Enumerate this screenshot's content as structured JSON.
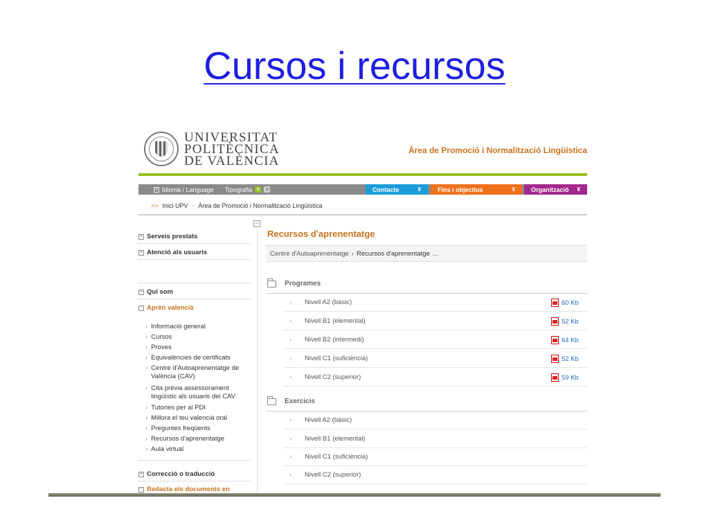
{
  "slide": {
    "title": "Cursos i recursos"
  },
  "header": {
    "university_lines": [
      "UNIVERSITAT",
      "POLITÈCNICA",
      "DE VALÈNCIA"
    ],
    "area_title": "Àrea de Promoció i Normalització Lingüística"
  },
  "navbar": {
    "language": "Idioma / Language",
    "typography": "Tipografia",
    "typo_a": "a",
    "typo_b": "a",
    "tabs": [
      {
        "label": "Contacte",
        "color": "#1c9cd8"
      },
      {
        "label": "Fins i objectius",
        "color": "#f0711d"
      },
      {
        "label": "Organització",
        "color": "#a3288c"
      }
    ]
  },
  "breadcrumb": {
    "arrows": ">>",
    "home": "Inici UPV",
    "current": "Àrea de Promoció i Normalització Lingüística"
  },
  "sidebar": {
    "top": [
      {
        "label": "Serveis prestats",
        "toggle": "+"
      },
      {
        "label": "Atenció als usuaris",
        "toggle": "+"
      }
    ],
    "qui_som": {
      "label": "Qui som",
      "toggle": "+"
    },
    "apren": {
      "label": "Aprèn valencià",
      "toggle": "-"
    },
    "sub_items": [
      "Informació general",
      "Cursos",
      "Proves",
      "Equivalències de certificats",
      "Centre d'Autoaprenentatge de València (CAV)",
      "Cita prèvia assessorament lingüístic als usuaris del CAV",
      "Tutories per al PDI",
      "Millora el teu valencià oral",
      "Preguntes freqüents",
      "Recursos d'aprenentatge",
      "Aula virtual"
    ],
    "bottom": [
      {
        "label": "Correcció o traducció",
        "toggle": "+"
      },
      {
        "label": "Redacta els documents en",
        "toggle": "-"
      }
    ]
  },
  "main": {
    "title": "Recursos d'aprenentatge",
    "crumb_parent": "Centre d'Autoaprenentatge",
    "crumb_sep": "›",
    "crumb_current": "Recursos d'aprenentatge",
    "crumb_more": "...",
    "sections": [
      {
        "title": "Programes",
        "rows": [
          {
            "label": "Nivell A2 (bàsic)",
            "size": "60 Kb"
          },
          {
            "label": "Nivell B1 (elemental)",
            "size": "52 Kb"
          },
          {
            "label": "Nivell B2 (intermedi)",
            "size": "64 Kb"
          },
          {
            "label": "Nivell C1 (suficiència)",
            "size": "52 Kb"
          },
          {
            "label": "Nivell C2 (superior)",
            "size": "59 Kb"
          }
        ]
      },
      {
        "title": "Exercicis",
        "rows": [
          {
            "label": "Nivell A2 (bàsic)"
          },
          {
            "label": "Nivell B1 (elemental)"
          },
          {
            "label": "Nivell C1 (suficiència)"
          },
          {
            "label": "Nivell C2 (superior)"
          }
        ]
      }
    ]
  }
}
